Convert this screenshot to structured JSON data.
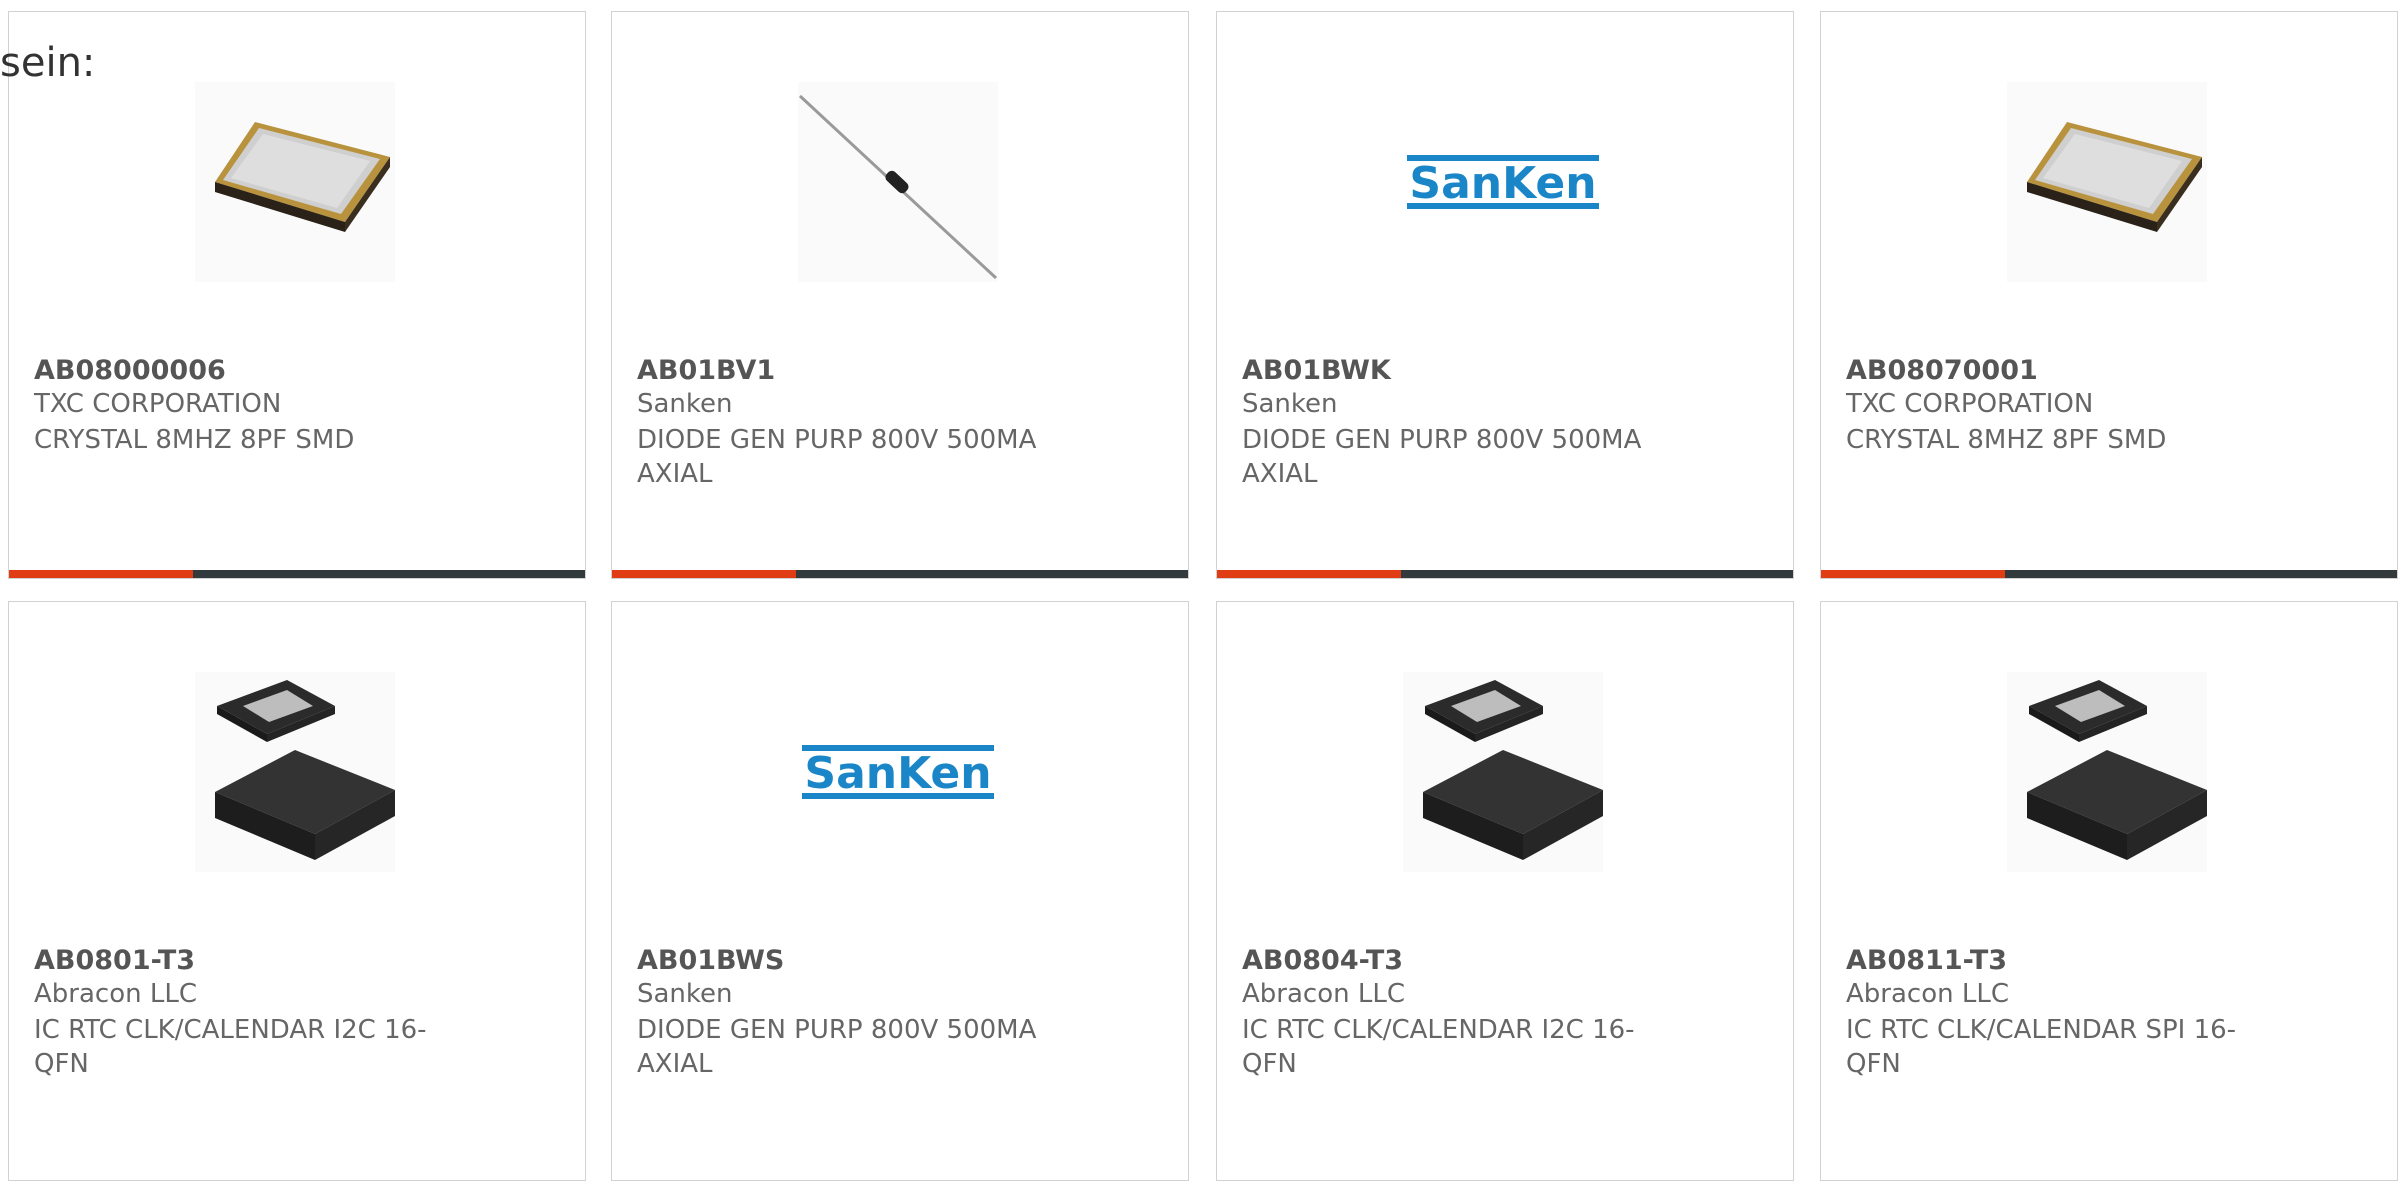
{
  "intro": {
    "text": "sein:"
  },
  "colors": {
    "accent": "#e03d14",
    "bar": "#333a3e",
    "sanken_blue": "#1a86c8"
  },
  "products": [
    {
      "part": "AB08000006",
      "manufacturer": "TXC CORPORATION",
      "description": "CRYSTAL 8MHZ 8PF SMD",
      "image": "crystal-smd-image"
    },
    {
      "part": "AB01BV1",
      "manufacturer": "Sanken",
      "description": "DIODE GEN PURP 800V 500MA AXIAL",
      "image": "axial-diode-image"
    },
    {
      "part": "AB01BWK",
      "manufacturer": "Sanken",
      "description": "DIODE GEN PURP 800V 500MA AXIAL",
      "image": "sanken-logo"
    },
    {
      "part": "AB08070001",
      "manufacturer": "TXC CORPORATION",
      "description": "CRYSTAL 8MHZ 8PF SMD",
      "image": "crystal-smd-image"
    },
    {
      "part": "AB0801-T3",
      "manufacturer": "Abracon LLC",
      "description": "IC RTC CLK/CALENDAR I2C 16-QFN",
      "image": "qfn-chip-image"
    },
    {
      "part": "AB01BWS",
      "manufacturer": "Sanken",
      "description": "DIODE GEN PURP 800V 500MA AXIAL",
      "image": "sanken-logo"
    },
    {
      "part": "AB0804-T3",
      "manufacturer": "Abracon LLC",
      "description": "IC RTC CLK/CALENDAR I2C 16-QFN",
      "image": "qfn-chip-image"
    },
    {
      "part": "AB0811-T3",
      "manufacturer": "Abracon LLC",
      "description": "IC RTC CLK/CALENDAR SPI 16-QFN",
      "image": "qfn-chip-image"
    }
  ]
}
